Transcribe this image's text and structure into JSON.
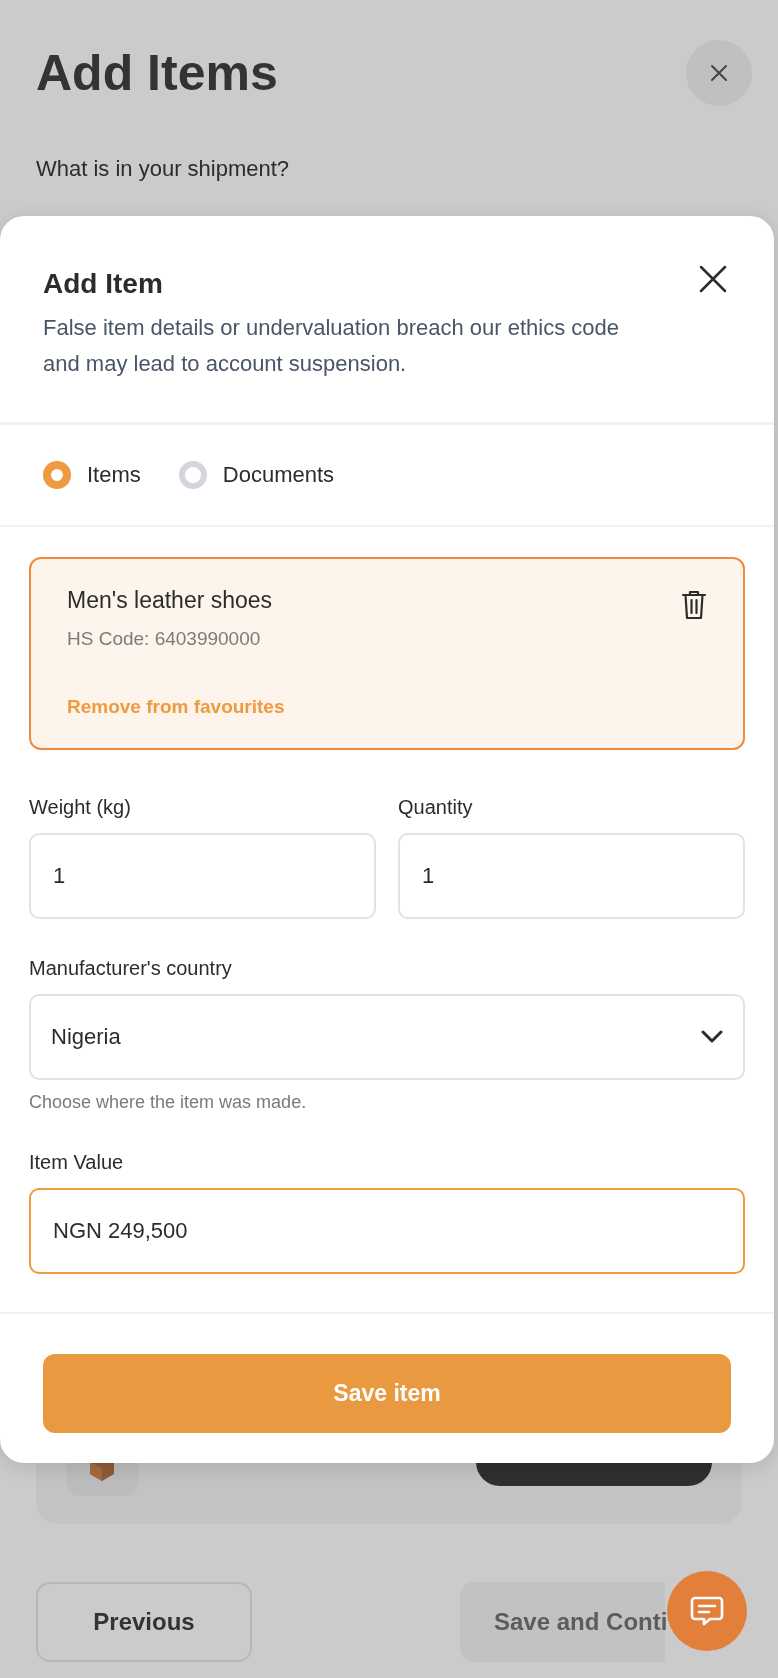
{
  "page": {
    "title": "Add Items",
    "question": "What is in your shipment?"
  },
  "parcel_bar": {
    "kind": "parcel"
  },
  "footer": {
    "previous": "Previous",
    "next": {
      "label": "Save and Conti",
      "disabled": true
    }
  },
  "modal": {
    "title": "Add Item",
    "warning": "False item details or undervaluation breach our ethics code and may lead to account suspension.",
    "types": [
      {
        "label": "Items",
        "selected": true
      },
      {
        "label": "Documents",
        "selected": false
      }
    ],
    "item": {
      "name": "Men's leather shoes",
      "hs_code": "HS Code: 6403990000",
      "action": "Remove from favourites"
    },
    "fields": [
      {
        "kind": "text",
        "label": "Weight (kg)",
        "value": "1",
        "focused": false
      },
      {
        "kind": "text",
        "label": "Quantity",
        "value": "1",
        "focused": false
      },
      {
        "kind": "select",
        "label": "Manufacturer's country",
        "value": "Nigeria",
        "hint": "Choose where the item was made.",
        "focused": false
      },
      {
        "kind": "text",
        "label": "Item Value",
        "value": "NGN 249,500",
        "focused": true
      }
    ],
    "save": "Save item"
  }
}
